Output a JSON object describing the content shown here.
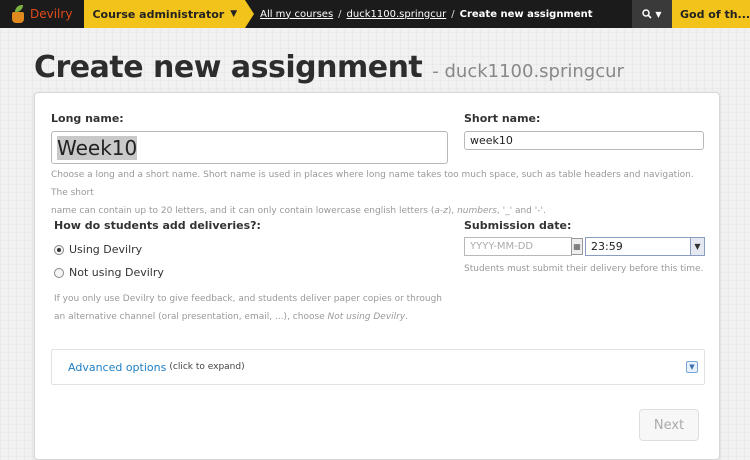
{
  "topbar": {
    "brand": "Devilry",
    "role": "Course administrator",
    "breadcrumb": {
      "all_courses": "All my courses",
      "course": "duck1100.springcur",
      "current": "Create new assignment",
      "separator": "/"
    },
    "user": "God of th...",
    "colors": {
      "bar": "#1b1b1b",
      "accent": "#f2c31b",
      "brand": "#e24a1a"
    }
  },
  "heading": {
    "title": "Create new assignment",
    "subtitle": "- duck1100.springcur"
  },
  "form": {
    "long_name": {
      "label": "Long name:",
      "value": "Week10"
    },
    "short_name": {
      "label": "Short name:",
      "value": "week10"
    },
    "names_help_1": "Choose a long and a short name. Short name is used in places where long name takes too much space, such as table headers and navigation. The short",
    "names_help_2_prefix": "name can contain up to 20 letters, and it can only contain lowercase english letters (",
    "names_help_2_az": "a-z",
    "names_help_2_mid": "), ",
    "names_help_2_numbers": "numbers",
    "names_help_2_rest": ", '_' and '-'.",
    "delivery": {
      "label": "How do students add deliveries?:",
      "options": [
        {
          "label": "Using Devilry",
          "selected": true
        },
        {
          "label": "Not using Devilry",
          "selected": false
        }
      ],
      "help_1": "If you only use Devilry to give feedback, and students deliver paper copies or through",
      "help_2_prefix": "an alternative channel (oral presentation, email, ...), choose ",
      "help_2_em": "Not using Devilry",
      "help_2_suffix": "."
    },
    "submission": {
      "label": "Submission date:",
      "date_placeholder": "YYYY-MM-DD",
      "time_value": "23:59",
      "help": "Students must submit their delivery before this time."
    },
    "advanced": {
      "title": "Advanced options",
      "hint": "(click to expand)"
    },
    "next_label": "Next"
  }
}
